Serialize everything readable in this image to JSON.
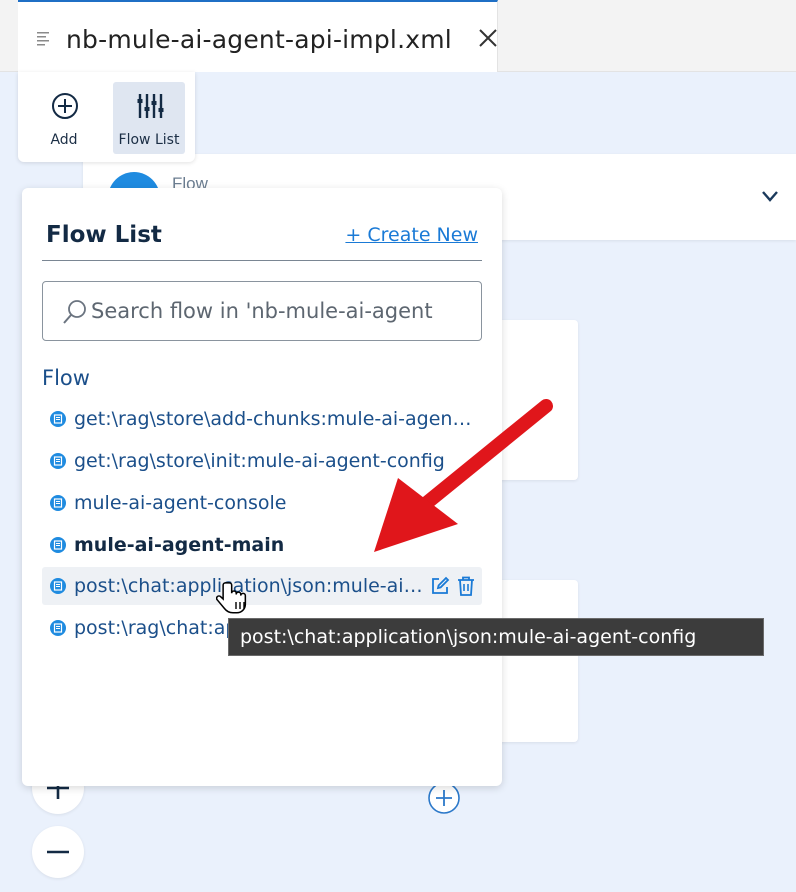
{
  "tab": {
    "title": "nb-mule-ai-agent-api-impl.xml",
    "icon": "lines-icon",
    "close_icon": "close-icon"
  },
  "toolbar": {
    "add_label": "Add",
    "flowlist_label": "Flow List"
  },
  "canvas": {
    "flow_header_label": "Flow"
  },
  "panel": {
    "title": "Flow List",
    "create_new": "+ Create New",
    "search_placeholder": "Search flow in 'nb-mule-ai-agent",
    "section_title": "Flow",
    "items": [
      {
        "label": "get:\\rag\\store\\add-chunks:mule-ai-agent-config",
        "bold": false,
        "hovered": false
      },
      {
        "label": "get:\\rag\\store\\init:mule-ai-agent-config",
        "bold": false,
        "hovered": false
      },
      {
        "label": "mule-ai-agent-console",
        "bold": false,
        "hovered": false
      },
      {
        "label": "mule-ai-agent-main",
        "bold": true,
        "hovered": false
      },
      {
        "label": "post:\\chat:application\\json:mule-ai-agent-config",
        "bold": false,
        "hovered": true
      },
      {
        "label": "post:\\rag\\chat:ap",
        "bold": false,
        "hovered": false
      }
    ]
  },
  "tooltip": {
    "text": "post:\\chat:application\\json:mule-ai-agent-config"
  },
  "colors": {
    "accent": "#1a7ad6",
    "flow_icon": "#1f8be0",
    "canvas_bg": "#eaf1fc",
    "annotation_arrow": "#e0161b"
  }
}
